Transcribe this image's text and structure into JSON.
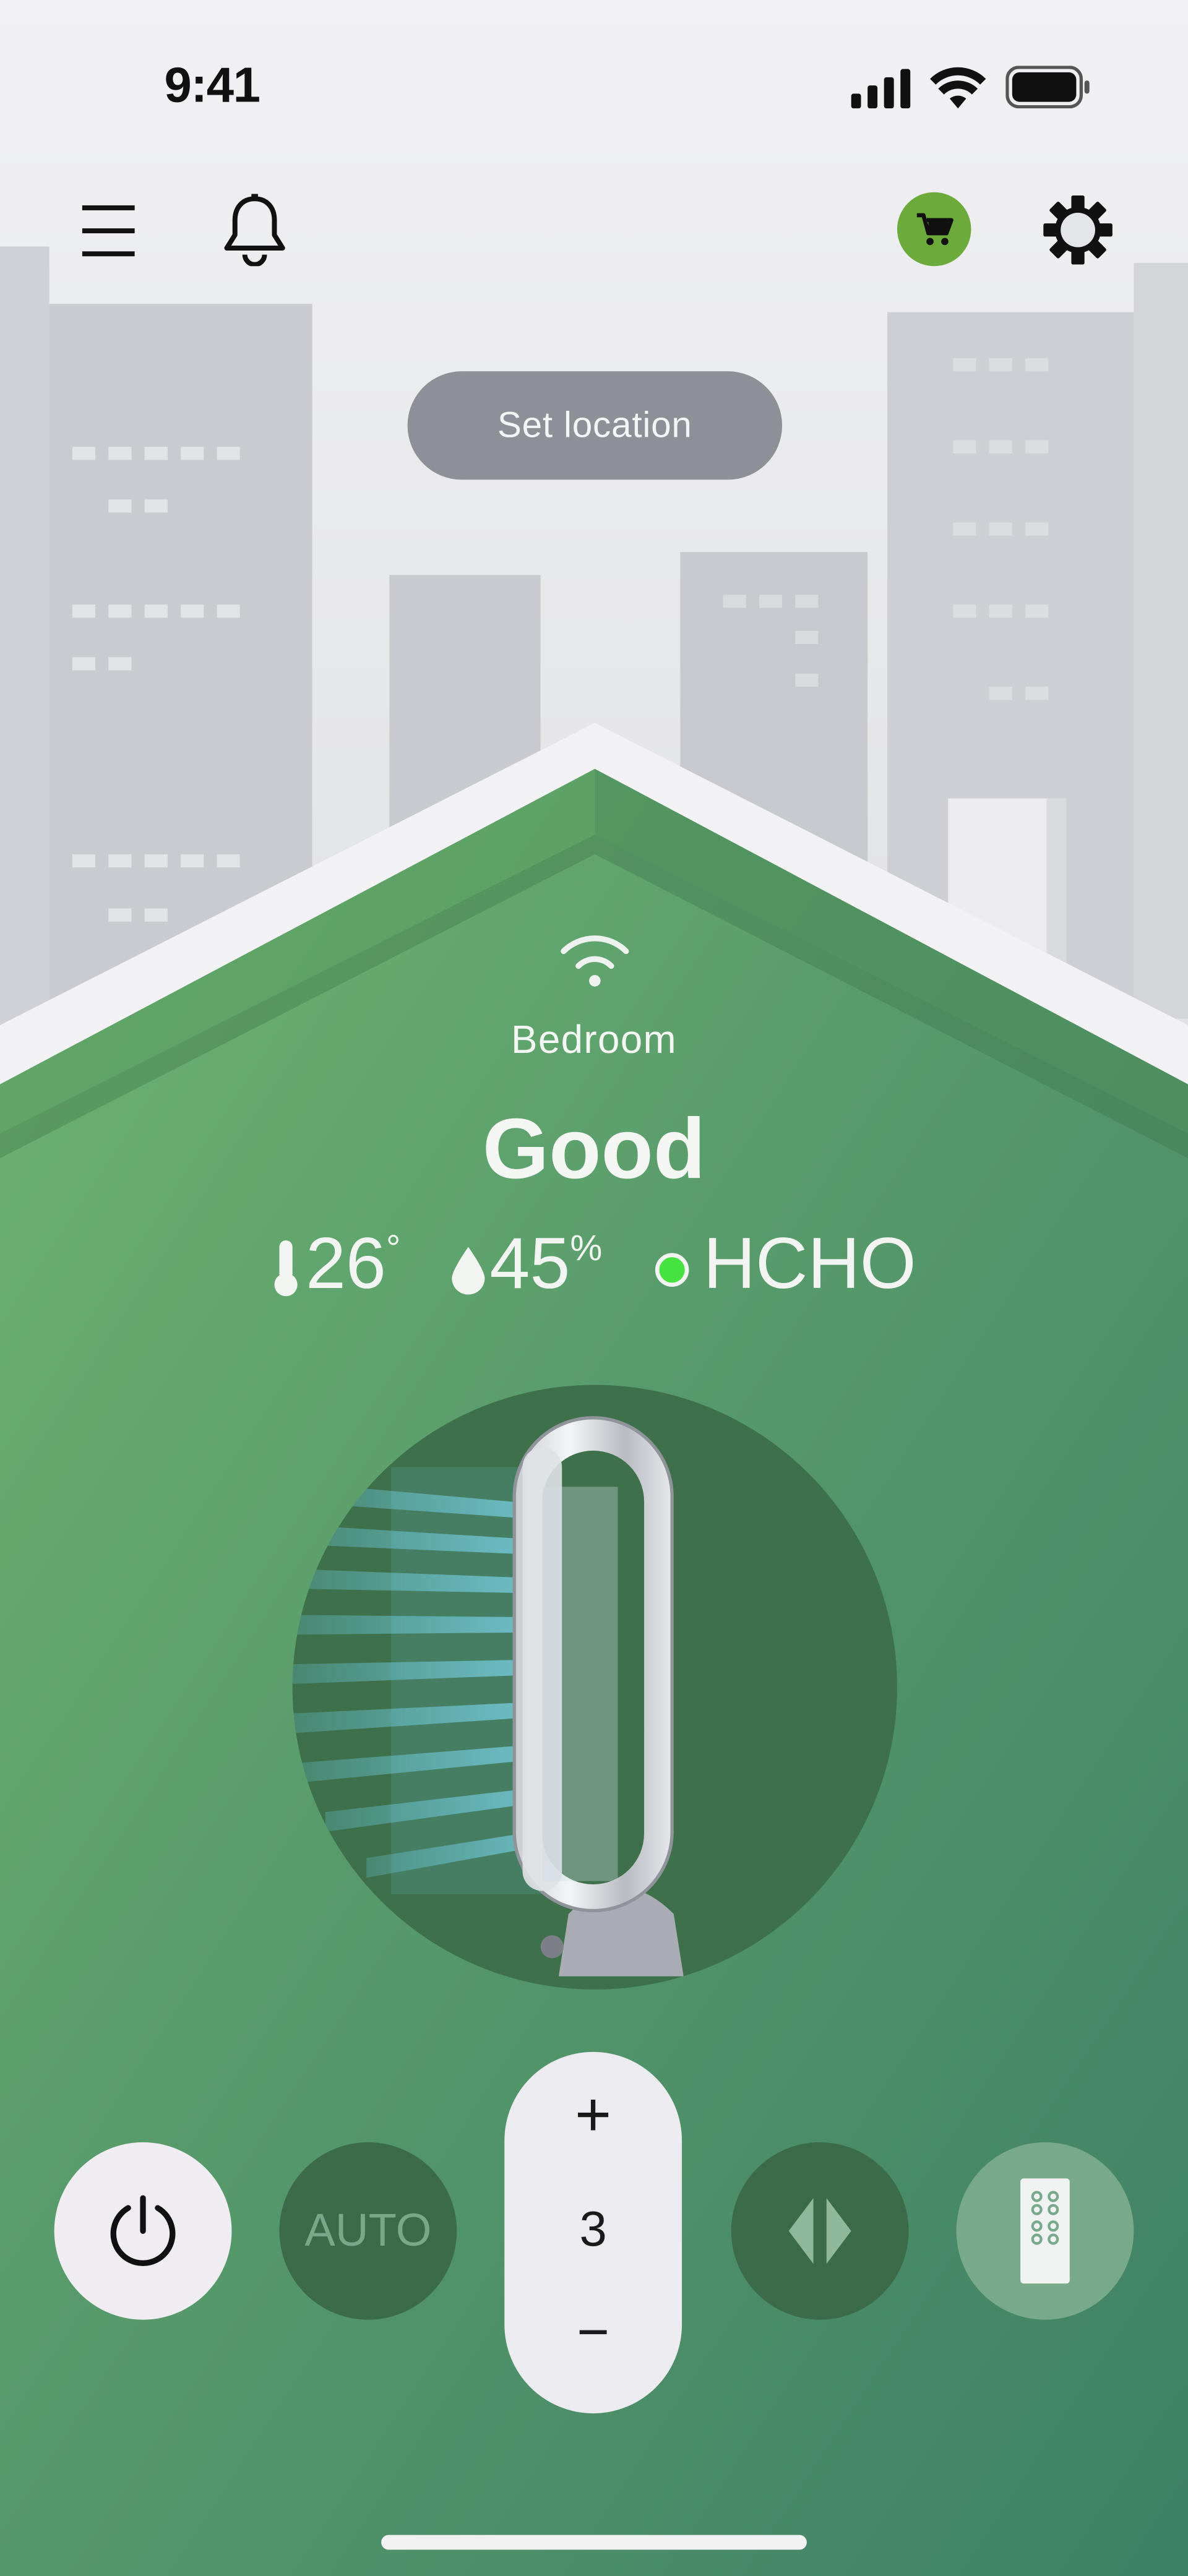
{
  "status_bar": {
    "time": "9:41"
  },
  "top_nav": {
    "menu_icon": "hamburger-menu-icon",
    "notifications_icon": "bell-icon",
    "cart_icon": "shopping-cart-icon",
    "settings_icon": "gear-icon",
    "cart_color": "#6cab3b"
  },
  "location_button": {
    "label": "Set location"
  },
  "room": {
    "connection_icon": "wifi-icon",
    "name": "Bedroom",
    "air_quality": "Good",
    "temperature": {
      "value": "26",
      "unit": "°"
    },
    "humidity": {
      "value": "45",
      "unit": "%"
    },
    "hcho": {
      "label": "HCHO",
      "status_color": "#46e340"
    }
  },
  "controls": {
    "power_icon": "power-icon",
    "auto_label": "AUTO",
    "speed": {
      "increase": "+",
      "value": "3",
      "decrease": "−"
    },
    "oscillation_icon": "oscillation-icon",
    "remote_icon": "remote-control-icon"
  },
  "colors": {
    "house_green": "#5fa469",
    "control_dark": "#3b6b48",
    "sky": "#e3e4e7"
  }
}
